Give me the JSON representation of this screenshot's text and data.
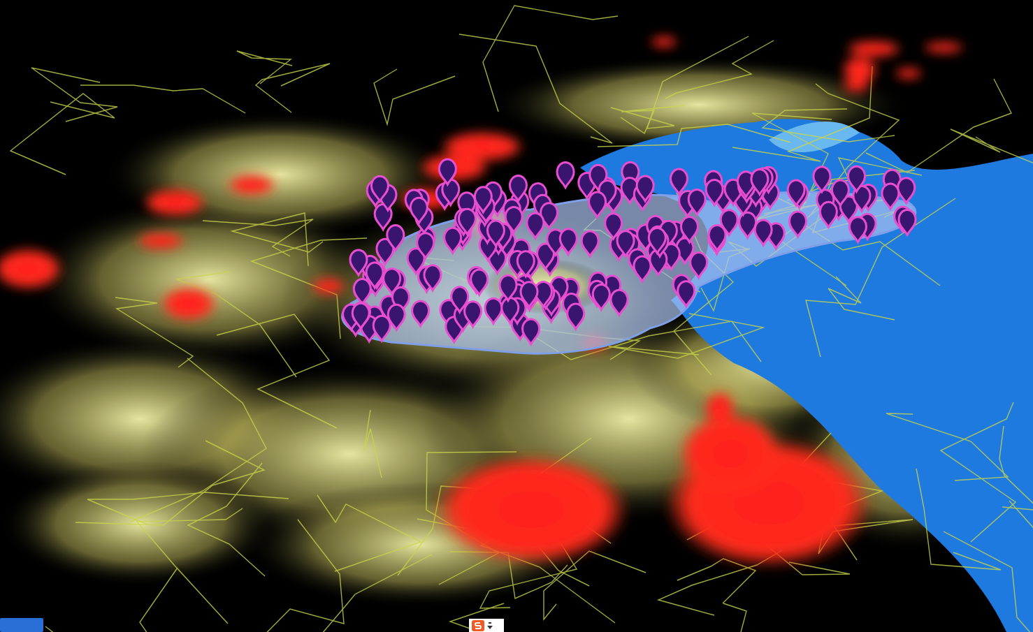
{
  "map": {
    "layers": [
      {
        "kind": "base"
      },
      {
        "kind": "heatmap"
      },
      {
        "kind": "region"
      },
      {
        "kind": "markers"
      }
    ]
  },
  "logo": {
    "kind": "map-logo"
  },
  "ime_toolbar": {
    "kind": "ime"
  }
}
